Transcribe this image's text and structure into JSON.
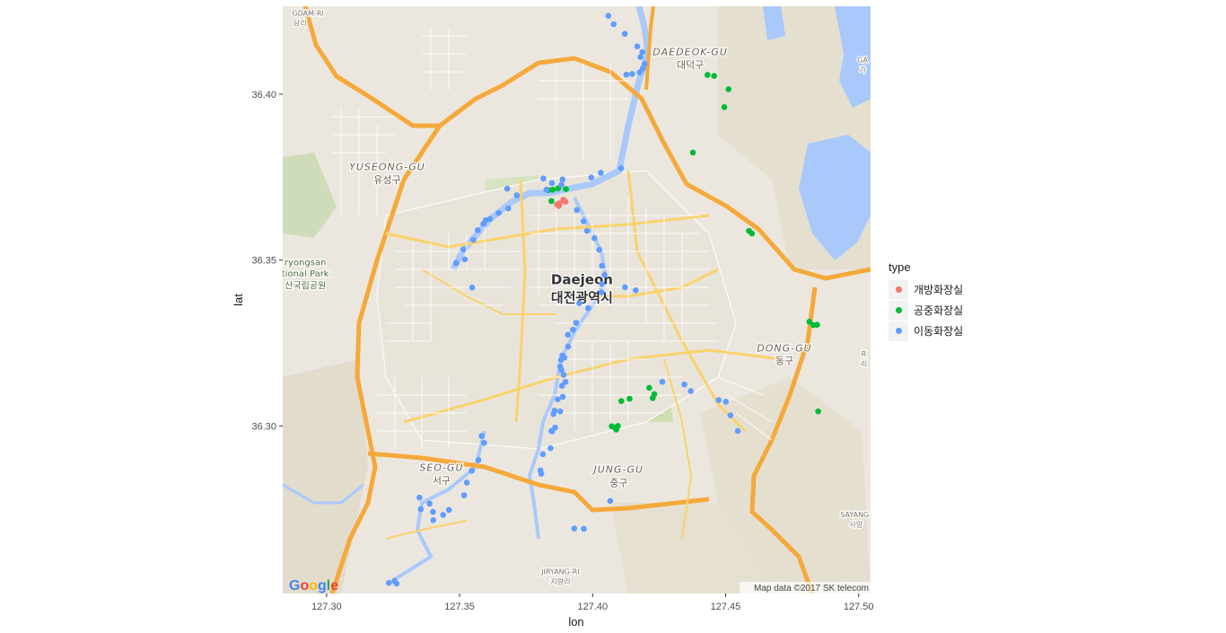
{
  "chart_data": {
    "type": "scatter",
    "title": "",
    "xlabel": "lon",
    "ylabel": "lat",
    "xlim": [
      127.2835,
      127.5045
    ],
    "ylim": [
      36.2495,
      36.4265
    ],
    "x_ticks": [
      127.3,
      127.35,
      127.4,
      127.45,
      127.5
    ],
    "x_tick_labels": [
      "127.30",
      "127.35",
      "127.40",
      "127.45",
      "127.50"
    ],
    "y_ticks": [
      36.3,
      36.35,
      36.4
    ],
    "y_tick_labels": [
      "36.30",
      "36.35",
      "36.40"
    ],
    "legend": {
      "title": "type",
      "position": "right"
    },
    "basemap": {
      "attribution": "Map data ©2017 SK telecom",
      "logo": "Google",
      "labels": [
        {
          "text": "Daejeon",
          "lon": 127.396,
          "lat": 36.3428,
          "kind": "city"
        },
        {
          "text": "대전광역시",
          "lon": 127.396,
          "lat": 36.3373,
          "kind": "city"
        },
        {
          "text": "DAEDEOK-GU",
          "lon": 127.4367,
          "lat": 36.4117,
          "kind": "district"
        },
        {
          "text": "대덕구",
          "lon": 127.4367,
          "lat": 36.4078,
          "kind": "district-kr"
        },
        {
          "text": "YUSEONG-GU",
          "lon": 127.3228,
          "lat": 36.3771,
          "kind": "district"
        },
        {
          "text": "유성구",
          "lon": 127.3228,
          "lat": 36.3732,
          "kind": "district-kr"
        },
        {
          "text": "DONG-GU",
          "lon": 127.4721,
          "lat": 36.3225,
          "kind": "district"
        },
        {
          "text": "동구",
          "lon": 127.4721,
          "lat": 36.3186,
          "kind": "district-kr"
        },
        {
          "text": "SEO-GU",
          "lon": 127.3432,
          "lat": 36.2864,
          "kind": "district"
        },
        {
          "text": "서구",
          "lon": 127.3432,
          "lat": 36.2825,
          "kind": "district-kr"
        },
        {
          "text": "JUNG-GU",
          "lon": 127.4098,
          "lat": 36.2859,
          "kind": "district"
        },
        {
          "text": "중구",
          "lon": 127.4098,
          "lat": 36.2819,
          "kind": "district-kr"
        },
        {
          "text": "ryongsan",
          "lon": 127.292,
          "lat": 36.3484,
          "kind": "park"
        },
        {
          "text": "tional Park",
          "lon": 127.292,
          "lat": 36.345,
          "kind": "park"
        },
        {
          "text": "산국립공원",
          "lon": 127.292,
          "lat": 36.3414,
          "kind": "park"
        },
        {
          "text": "SAYANG-",
          "lon": 127.499,
          "lat": 36.2725,
          "kind": "small"
        },
        {
          "text": "사양",
          "lon": 127.499,
          "lat": 36.2695,
          "kind": "small"
        },
        {
          "text": "JIRYANG-RI",
          "lon": 127.3879,
          "lat": 36.2553,
          "kind": "small"
        },
        {
          "text": "지량리",
          "lon": 127.3879,
          "lat": 36.2523,
          "kind": "small"
        },
        {
          "text": "GDAM-RI",
          "lon": 127.293,
          "lat": 36.4237,
          "kind": "small"
        },
        {
          "text": "담리",
          "lon": 127.29,
          "lat": 36.4207,
          "kind": "small"
        },
        {
          "text": "GA",
          "lon": 127.5015,
          "lat": 36.4096,
          "kind": "small"
        },
        {
          "text": "가",
          "lon": 127.5015,
          "lat": 36.4066,
          "kind": "small"
        },
        {
          "text": "R",
          "lon": 127.502,
          "lat": 36.321,
          "kind": "small"
        },
        {
          "text": "리",
          "lon": 127.502,
          "lat": 36.318,
          "kind": "small"
        }
      ]
    },
    "series": [
      {
        "name": "개방화장실",
        "color": "#F8766D",
        "points": [
          [
            127.3866,
            36.3668
          ],
          [
            127.3876,
            36.3671
          ],
          [
            127.389,
            36.3682
          ],
          [
            127.3898,
            36.3676
          ],
          [
            127.3873,
            36.3663
          ]
        ]
      },
      {
        "name": "공중화장실",
        "color": "#00BA38",
        "points": [
          [
            127.3834,
            36.3711
          ],
          [
            127.385,
            36.3712
          ],
          [
            127.387,
            36.3716
          ],
          [
            127.39,
            36.3714
          ],
          [
            127.3845,
            36.3678
          ],
          [
            127.4432,
            36.4058
          ],
          [
            127.4457,
            36.4055
          ],
          [
            127.4511,
            36.4015
          ],
          [
            127.4495,
            36.3961
          ],
          [
            127.4377,
            36.3824
          ],
          [
            127.4588,
            36.3588
          ],
          [
            127.4599,
            36.358
          ],
          [
            127.4815,
            36.3314
          ],
          [
            127.483,
            36.3304
          ],
          [
            127.4844,
            36.3305
          ],
          [
            127.4848,
            36.3044
          ],
          [
            127.4213,
            36.3115
          ],
          [
            127.4232,
            36.3096
          ],
          [
            127.4226,
            36.3084
          ],
          [
            127.4139,
            36.3082
          ],
          [
            127.4108,
            36.3075
          ],
          [
            127.4072,
            36.2999
          ],
          [
            127.4089,
            36.2989
          ],
          [
            127.4095,
            36.3
          ],
          [
            127.4084,
            36.2995
          ]
        ]
      },
      {
        "name": "이동화장실",
        "color": "#619CFF",
        "points": [
          [
            127.4059,
            36.4236
          ],
          [
            127.4079,
            36.4211
          ],
          [
            127.4121,
            36.4182
          ],
          [
            127.4168,
            36.4144
          ],
          [
            127.4187,
            36.4127
          ],
          [
            127.418,
            36.4112
          ],
          [
            127.4196,
            36.4092
          ],
          [
            127.4189,
            36.4078
          ],
          [
            127.4177,
            36.4066
          ],
          [
            127.4149,
            36.4061
          ],
          [
            127.4127,
            36.4059
          ],
          [
            127.4107,
            36.3777
          ],
          [
            127.4031,
            36.3763
          ],
          [
            127.3995,
            36.3749
          ],
          [
            127.3887,
            36.3743
          ],
          [
            127.3815,
            36.3746
          ],
          [
            127.3826,
            36.3712
          ],
          [
            127.3847,
            36.3732
          ],
          [
            127.3883,
            36.3727
          ],
          [
            127.3679,
            36.3715
          ],
          [
            127.3715,
            36.3695
          ],
          [
            127.3683,
            36.3656
          ],
          [
            127.3647,
            36.3642
          ],
          [
            127.3614,
            36.3624
          ],
          [
            127.3598,
            36.362
          ],
          [
            127.3589,
            36.3609
          ],
          [
            127.3568,
            36.359
          ],
          [
            127.3552,
            36.3561
          ],
          [
            127.3514,
            36.3532
          ],
          [
            127.352,
            36.3502
          ],
          [
            127.3487,
            36.3491
          ],
          [
            127.3547,
            36.3417
          ],
          [
            127.3966,
            36.3617
          ],
          [
            127.3941,
            36.3651
          ],
          [
            127.3979,
            36.3588
          ],
          [
            127.4007,
            36.3566
          ],
          [
            127.4025,
            36.3531
          ],
          [
            127.4035,
            36.3483
          ],
          [
            127.4045,
            36.3455
          ],
          [
            127.4035,
            36.3428
          ],
          [
            127.4034,
            36.3403
          ],
          [
            127.4122,
            36.3418
          ],
          [
            127.395,
            36.337
          ],
          [
            127.3983,
            36.3355
          ],
          [
            127.3938,
            36.3311
          ],
          [
            127.3926,
            36.329
          ],
          [
            127.3907,
            36.3275
          ],
          [
            127.3908,
            36.3239
          ],
          [
            127.3894,
            36.3206
          ],
          [
            127.3886,
            36.3212
          ],
          [
            127.3881,
            36.3199
          ],
          [
            127.3883,
            36.3169
          ],
          [
            127.3878,
            36.3179
          ],
          [
            127.3891,
            36.3154
          ],
          [
            127.3898,
            36.3133
          ],
          [
            127.3885,
            36.3121
          ],
          [
            127.3888,
            36.3088
          ],
          [
            127.3869,
            36.308
          ],
          [
            127.3857,
            36.3046
          ],
          [
            127.3878,
            36.3044
          ],
          [
            127.3853,
            36.3036
          ],
          [
            127.3859,
            36.2995
          ],
          [
            127.3848,
            36.2984
          ],
          [
            127.3845,
            36.2985
          ],
          [
            127.3842,
            36.2933
          ],
          [
            127.3813,
            36.2915
          ],
          [
            127.3804,
            36.2866
          ],
          [
            127.3807,
            36.2856
          ],
          [
            127.3583,
            36.297
          ],
          [
            127.3592,
            36.2949
          ],
          [
            127.3571,
            36.2897
          ],
          [
            127.3546,
            36.2865
          ],
          [
            127.3527,
            36.2829
          ],
          [
            127.3517,
            36.2791
          ],
          [
            127.3387,
            36.2766
          ],
          [
            127.3349,
            36.2784
          ],
          [
            127.3354,
            36.2749
          ],
          [
            127.34,
            36.2741
          ],
          [
            127.346,
            36.2747
          ],
          [
            127.3438,
            36.2732
          ],
          [
            127.3401,
            36.2716
          ],
          [
            127.4066,
            36.2774
          ],
          [
            127.3931,
            36.2691
          ],
          [
            127.3967,
            36.269
          ],
          [
            127.4162,
            36.3409
          ],
          [
            127.4262,
            36.3133
          ],
          [
            127.4345,
            36.3125
          ],
          [
            127.4369,
            36.3105
          ],
          [
            127.4474,
            36.3078
          ],
          [
            127.4501,
            36.3073
          ],
          [
            127.4518,
            36.3032
          ],
          [
            127.4546,
            36.2985
          ],
          [
            127.3255,
            36.2533
          ],
          [
            127.3263,
            36.2525
          ],
          [
            127.3234,
            36.2527
          ]
        ]
      }
    ]
  }
}
